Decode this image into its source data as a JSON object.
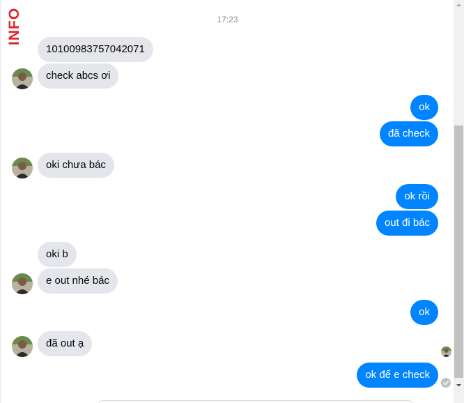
{
  "watermark": {
    "text": "INFO",
    "color": "#e0262a"
  },
  "timestamp": "17:23",
  "colors": {
    "incoming_bubble": "#e4e6eb",
    "outgoing_bubble": "#0084ff"
  },
  "messages": [
    {
      "direction": "incoming",
      "text": "10100983757042071"
    },
    {
      "direction": "incoming",
      "text": "check abcs ơi"
    },
    {
      "direction": "outgoing",
      "text": "ok"
    },
    {
      "direction": "outgoing",
      "text": "đã check"
    },
    {
      "direction": "incoming",
      "text": "oki chưa bác"
    },
    {
      "direction": "outgoing",
      "text": "ok rồi"
    },
    {
      "direction": "outgoing",
      "text": "out đi bác"
    },
    {
      "direction": "incoming",
      "text": "oki b"
    },
    {
      "direction": "incoming",
      "text": "e out nhé bác"
    },
    {
      "direction": "outgoing",
      "text": "ok"
    },
    {
      "direction": "incoming",
      "text": "đã out ạ"
    },
    {
      "direction": "outgoing",
      "text": "ok để e check"
    }
  ],
  "icons": {
    "contact_avatar": "contact-avatar-icon",
    "seen_indicator": "seen-avatar-icon",
    "delivered_indicator": "delivered-check-icon"
  }
}
